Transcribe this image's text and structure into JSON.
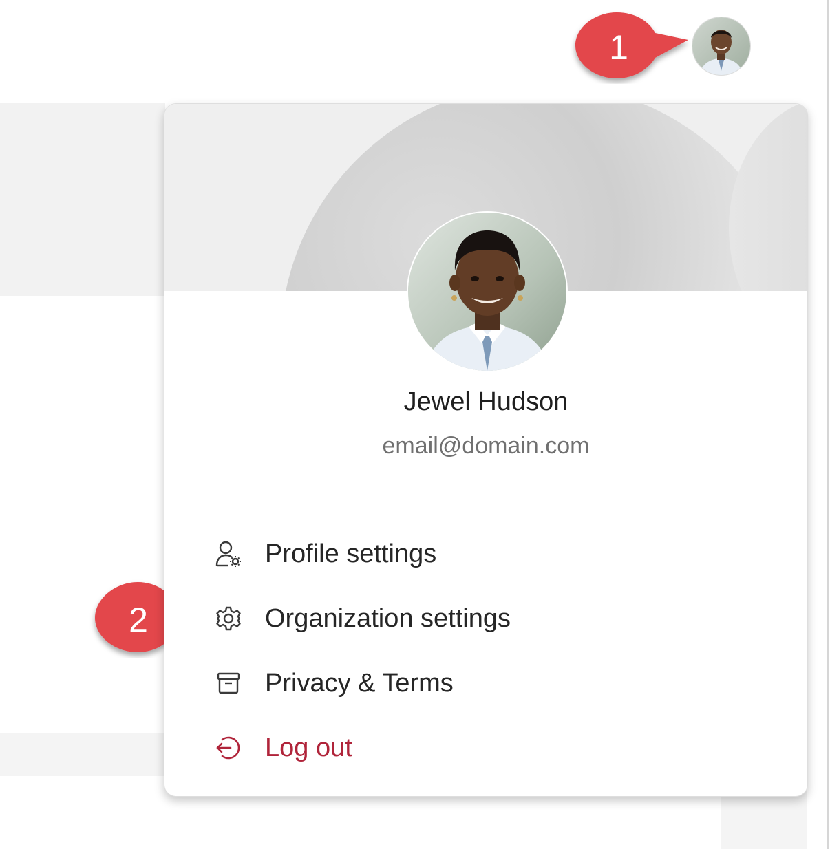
{
  "user": {
    "name": "Jewel Hudson",
    "email": "email@domain.com"
  },
  "menu": {
    "items": [
      {
        "label": "Profile settings",
        "icon": "user-settings-icon"
      },
      {
        "label": "Organization settings",
        "icon": "gear-icon"
      },
      {
        "label": "Privacy & Terms",
        "icon": "archive-box-icon"
      },
      {
        "label": "Log out",
        "icon": "logout-icon"
      }
    ]
  },
  "callouts": [
    {
      "number": "1"
    },
    {
      "number": "2"
    }
  ],
  "colors": {
    "callout": "#e3474b",
    "logout": "#b0243a",
    "text": "#262626",
    "email": "#707070"
  }
}
